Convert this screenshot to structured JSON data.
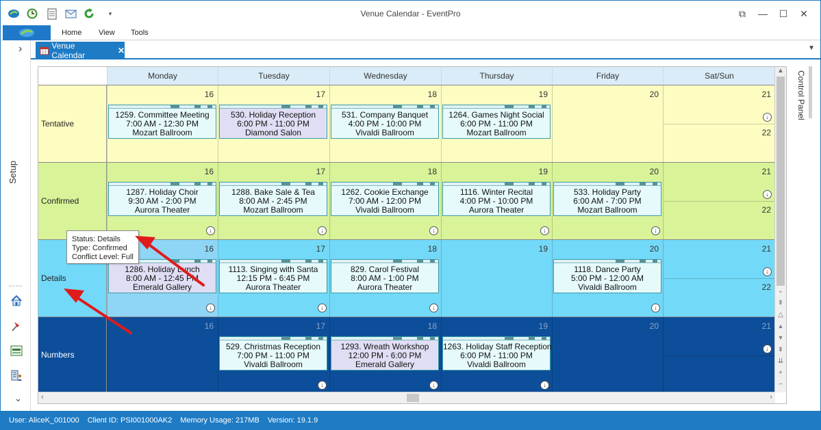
{
  "window": {
    "title": "Venue Calendar - EventPro",
    "qat_icons": [
      "app-logo-icon",
      "clock-icon",
      "document-icon",
      "mail-icon",
      "refresh-icon",
      "customize-dropdown-icon"
    ],
    "controls": {
      "restore": "⧉",
      "minimize": "—",
      "maximize": "☐",
      "close": "✕"
    }
  },
  "ribbon": {
    "menu": [
      "Home",
      "View",
      "Tools"
    ]
  },
  "leftnav": {
    "expand": "›",
    "setup_label": "Setup",
    "grip": "……",
    "collapse": "⌄"
  },
  "tab": {
    "label": "Venue Calendar",
    "close": "✕"
  },
  "calendar": {
    "days": [
      "Monday",
      "Tuesday",
      "Wednesday",
      "Thursday",
      "Friday",
      "Sat/Sun"
    ],
    "rows": [
      {
        "label": "Tentative",
        "color": "#fdfdc2",
        "text_color": "#222",
        "nums": [
          "16",
          "17",
          "18",
          "19",
          "20",
          "21"
        ],
        "sun": "22",
        "events": [
          {
            "day": 0,
            "lines": [
              "1259. Committee Meeting",
              "7:00 AM - 12:30 PM",
              "Mozart Ballroom"
            ]
          },
          {
            "day": 1,
            "lines": [
              "530. Holiday Reception",
              "6:00 PM - 11:00 PM",
              "Diamond Salon"
            ],
            "lav": true
          },
          {
            "day": 2,
            "lines": [
              "531. Company Banquet",
              "4:00 PM - 10:00 PM",
              "Vivaldi Ballroom"
            ]
          },
          {
            "day": 3,
            "lines": [
              "1264. Games Night Social",
              "6:00 PM - 11:00 PM",
              "Mozart Ballroom"
            ]
          }
        ]
      },
      {
        "label": "Confirmed",
        "color": "#d9f399",
        "text_color": "#222",
        "nums": [
          "16",
          "17",
          "18",
          "19",
          "20",
          "21"
        ],
        "sun": "22",
        "events": [
          {
            "day": 0,
            "lines": [
              "1287. Holiday Choir",
              "9:30 AM - 2:00 PM",
              "Aurora Theater"
            ]
          },
          {
            "day": 1,
            "lines": [
              "1288. Bake Sale & Tea",
              "8:00 AM - 2:45 PM",
              "Mozart Ballroom"
            ]
          },
          {
            "day": 2,
            "lines": [
              "1262. Cookie Exchange",
              "7:00 AM - 12:00 PM",
              "Vivaldi Ballroom"
            ]
          },
          {
            "day": 3,
            "lines": [
              "1116. Winter Recital",
              "4:00 PM - 10:00 PM",
              "Aurora Theater"
            ]
          },
          {
            "day": 4,
            "lines": [
              "533. Holiday Party",
              "6:00 AM - 7:00 PM",
              "Mozart Ballroom"
            ]
          }
        ]
      },
      {
        "label": "Details",
        "color": "#73d9f8",
        "text_color": "#222",
        "nums": [
          "16",
          "17",
          "18",
          "19",
          "20",
          "21"
        ],
        "sun": "22",
        "events": [
          {
            "day": 0,
            "lines": [
              "1286. Holiday Lunch",
              "8:00 AM - 12:45 PM",
              "Emerald Gallery"
            ],
            "lav": true
          },
          {
            "day": 1,
            "lines": [
              "1113. Singing with Santa",
              "12:15 PM - 6:45 PM",
              "Aurora Theater"
            ]
          },
          {
            "day": 2,
            "lines": [
              "829. Carol Festival",
              "8:00 AM - 1:00 PM",
              "Aurora Theater"
            ]
          },
          {
            "day": 4,
            "lines": [
              "1118. Dance Party",
              "5:00 PM - 12:00 AM",
              "Vivaldi Ballroom"
            ]
          }
        ]
      },
      {
        "label": "Numbers",
        "color": "#0d4e9a",
        "text_color": "#ffffff",
        "nums": [
          "16",
          "17",
          "18",
          "19",
          "20",
          "21"
        ],
        "sun": "",
        "events": [
          {
            "day": 1,
            "lines": [
              "529. Christmas Reception",
              "7:00 PM - 11:00 PM",
              "Vivaldi Ballroom"
            ]
          },
          {
            "day": 2,
            "lines": [
              "1293. Wreath Workshop",
              "12:00 PM - 6:00 PM",
              "Emerald Gallery"
            ],
            "lav": true
          },
          {
            "day": 3,
            "lines": [
              "1263. Holiday Staff Reception",
              "6:00 PM - 11:00 PM",
              "Vivaldi Ballroom"
            ]
          }
        ]
      }
    ]
  },
  "control_panel": {
    "label": "Control Panel"
  },
  "tooltip": {
    "lines": [
      "Status: Details",
      "Type: Confirmed",
      "Conflict Level: Full"
    ]
  },
  "annotation_color": "#e01b1b",
  "status_bar": {
    "user": "User: AliceK_001000",
    "client": "Client ID: PSI001000AK2",
    "memory": "Memory Usage: 217MB",
    "version": "Version: 19.1.9"
  }
}
